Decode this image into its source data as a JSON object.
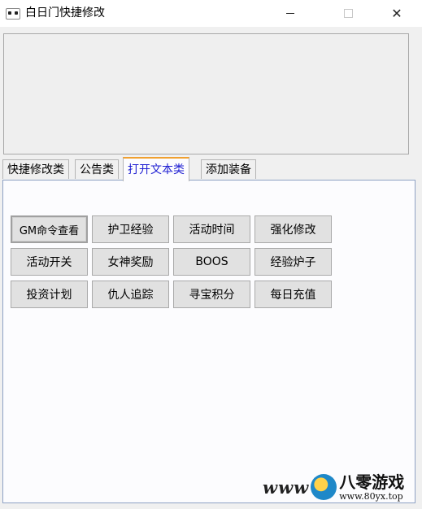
{
  "window": {
    "title": "白日门快捷修改",
    "controls": {
      "minimize": "minimize-icon",
      "maximize": "maximize-icon",
      "close": "close-icon"
    }
  },
  "tabs": [
    {
      "label": "快捷修改类",
      "active": false
    },
    {
      "label": "公告类",
      "active": false
    },
    {
      "label": "打开文本类",
      "active": true
    },
    {
      "label": "添加装备",
      "active": false
    }
  ],
  "buttons": [
    [
      "GM命令查看",
      "护卫经验",
      "活动时间",
      "强化修改"
    ],
    [
      "活动开关",
      "女神奖励",
      "BOOS",
      "经验炉子"
    ],
    [
      "投资计划",
      "仇人追踪",
      "寻宝积分",
      "每日充值"
    ]
  ],
  "watermark": {
    "prefix": "www",
    "brand": "八零游戏",
    "url": "www.80yx.top"
  },
  "colors": {
    "active_tab_text": "#1e1ed2",
    "active_tab_accent": "#f0a030",
    "panel_border": "#8ea2c4"
  }
}
